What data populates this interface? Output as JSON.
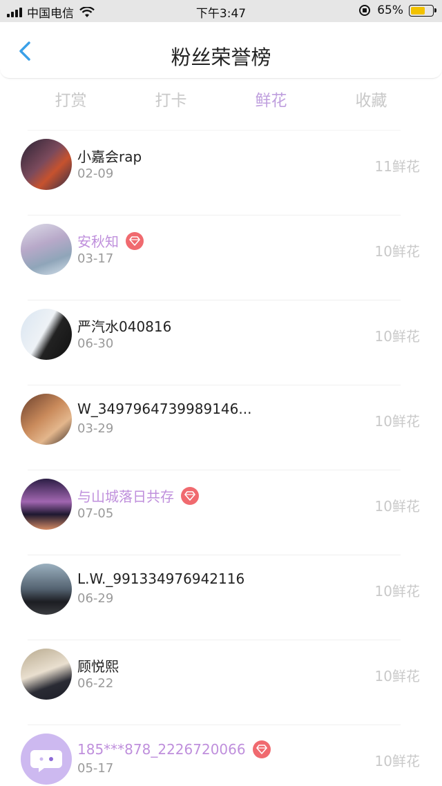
{
  "status_bar": {
    "carrier": "中国电信",
    "time": "下午3:47",
    "battery": "65%",
    "battery_level": 0.65
  },
  "header": {
    "title": "粉丝荣誉榜",
    "back_icon": "chevron-left-icon"
  },
  "tabs": [
    {
      "label": "打赏",
      "active": false
    },
    {
      "label": "打卡",
      "active": false
    },
    {
      "label": "鲜花",
      "active": true
    },
    {
      "label": "收藏",
      "active": false
    }
  ],
  "fans": [
    {
      "name": "小嘉会rap",
      "date": "02-09",
      "count": "11鲜花",
      "vip": false
    },
    {
      "name": "安秋知",
      "date": "03-17",
      "count": "10鲜花",
      "vip": true
    },
    {
      "name": "严汽水040816",
      "date": "06-30",
      "count": "10鲜花",
      "vip": false
    },
    {
      "name": "W_3497964739989146...",
      "date": "03-29",
      "count": "10鲜花",
      "vip": false
    },
    {
      "name": "与山城落日共存",
      "date": "07-05",
      "count": "10鲜花",
      "vip": true
    },
    {
      "name": "L.W._991334976942116",
      "date": "06-29",
      "count": "10鲜花",
      "vip": false
    },
    {
      "name": "顾悦熙",
      "date": "06-22",
      "count": "10鲜花",
      "vip": false
    },
    {
      "name": "185***878_2226720066",
      "date": "05-17",
      "count": "10鲜花",
      "vip": true
    }
  ],
  "colors": {
    "accent": "#bf9fde",
    "vip_name": "#bf8fdc",
    "gem_badge": "#f06a6f",
    "back_arrow": "#3aa0e8"
  }
}
